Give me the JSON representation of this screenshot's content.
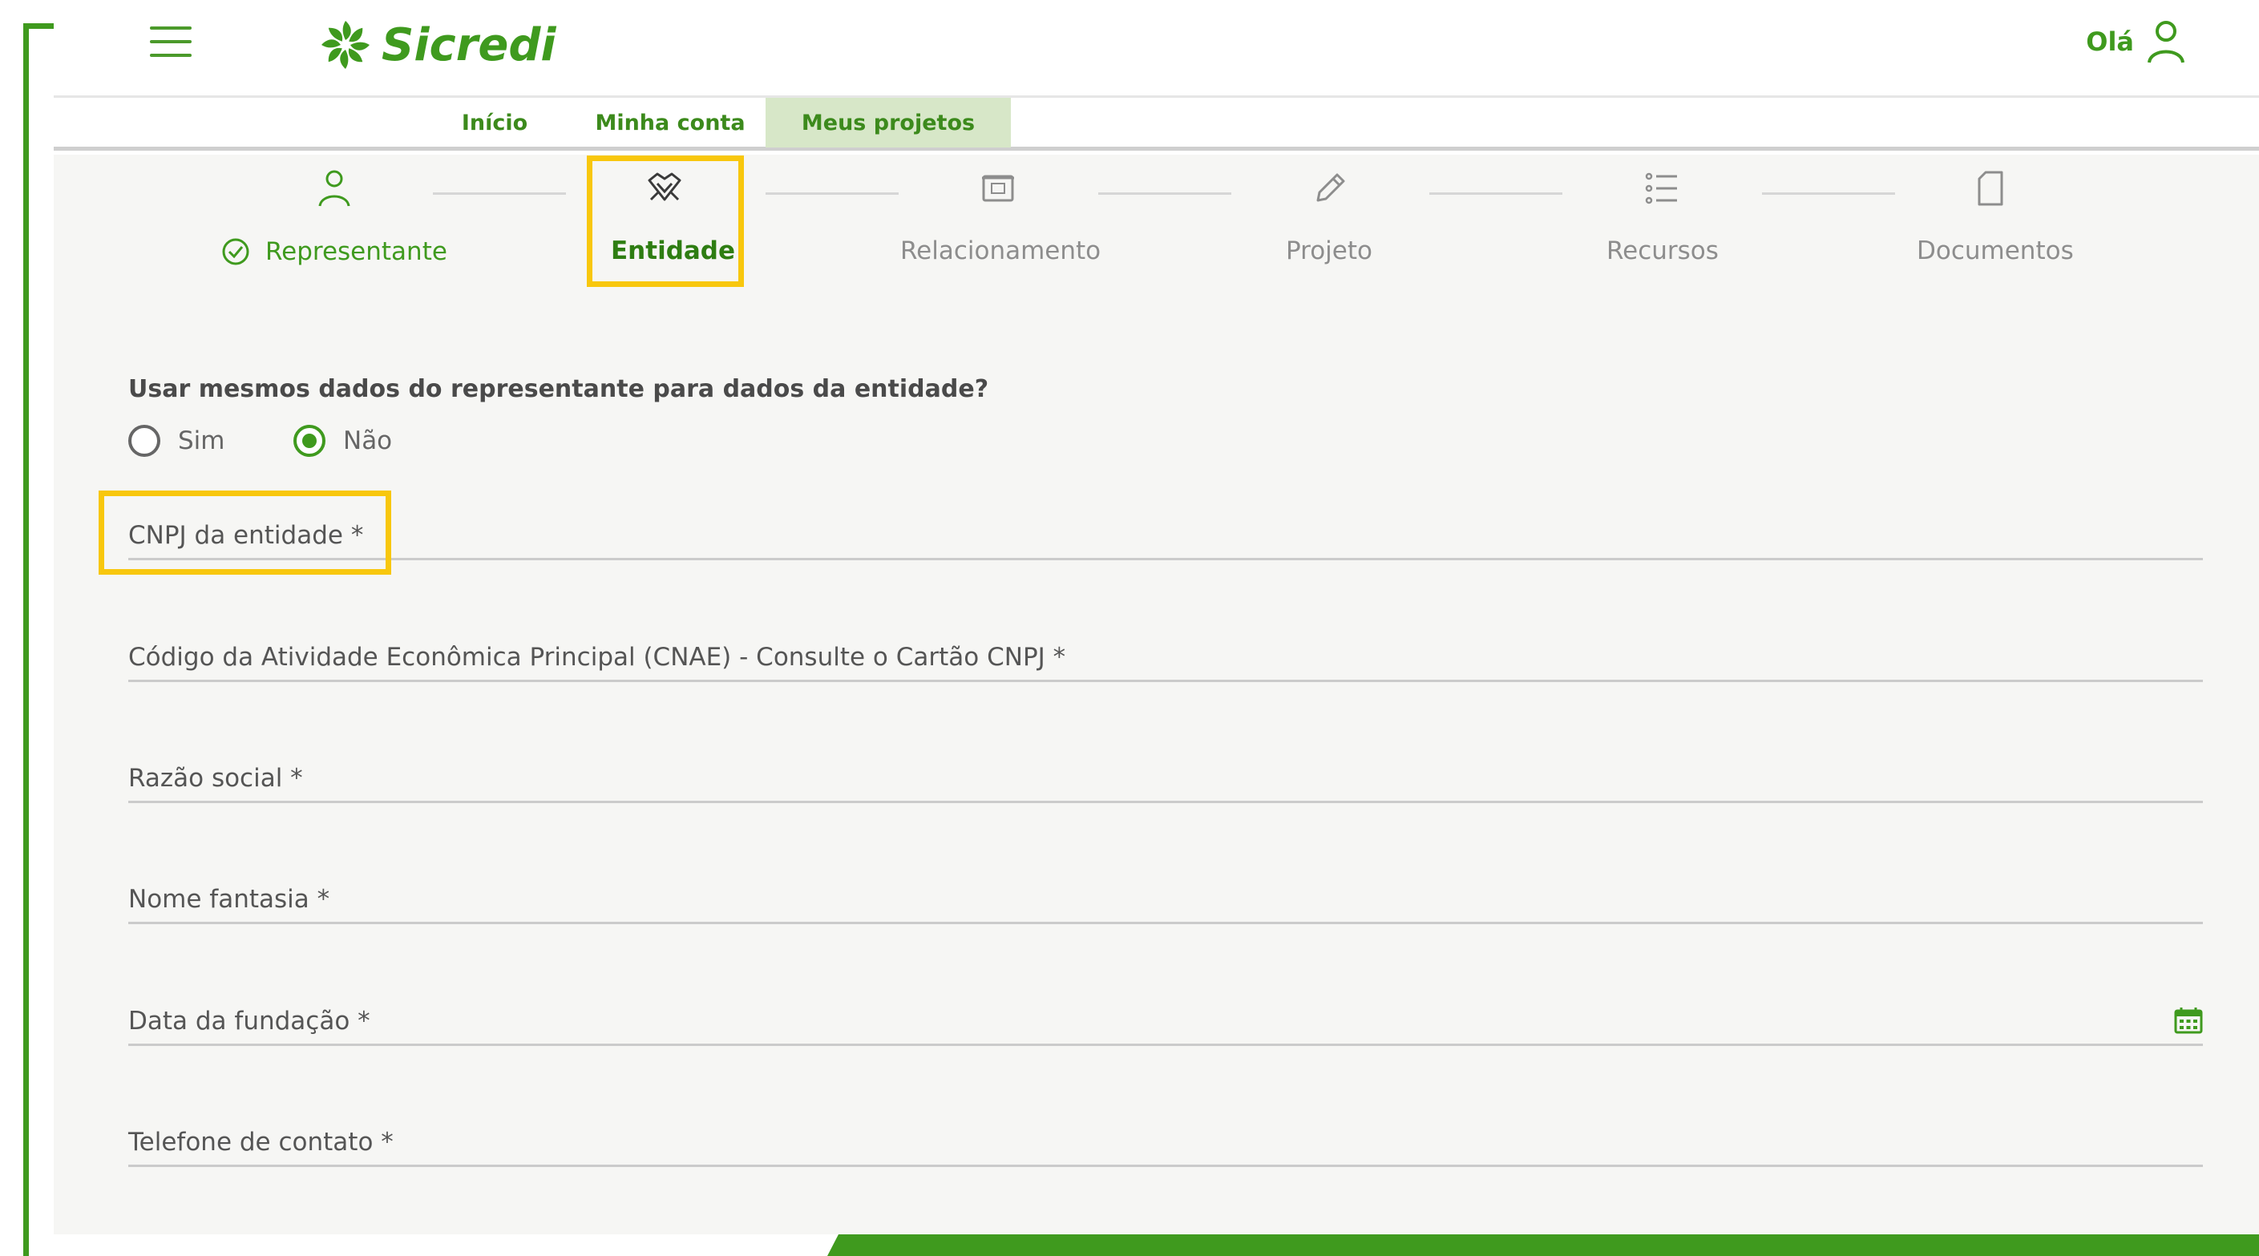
{
  "header": {
    "logo_text": "Sicredi",
    "greeting": "Olá",
    "brand_color": "#3f9a1e"
  },
  "nav": {
    "tabs": [
      {
        "label": "Início",
        "active": false
      },
      {
        "label": "Minha conta",
        "active": false
      },
      {
        "label": "Meus projetos",
        "active": true
      }
    ]
  },
  "stepper": {
    "steps": [
      {
        "label": "Representante",
        "icon": "person-icon",
        "state": "done"
      },
      {
        "label": "Entidade",
        "icon": "handshake-icon",
        "state": "active"
      },
      {
        "label": "Relacionamento",
        "icon": "bank-card-icon",
        "state": "pending"
      },
      {
        "label": "Projeto",
        "icon": "pencil-icon",
        "state": "pending"
      },
      {
        "label": "Recursos",
        "icon": "list-icon",
        "state": "pending"
      },
      {
        "label": "Documentos",
        "icon": "document-icon",
        "state": "pending"
      }
    ]
  },
  "form": {
    "question": "Usar mesmos dados do representante para dados da entidade?",
    "options": [
      {
        "label": "Sim",
        "checked": false
      },
      {
        "label": "Não",
        "checked": true
      }
    ],
    "fields": [
      {
        "label": "CNPJ da entidade *",
        "value": ""
      },
      {
        "label": "Código da Atividade Econômica Principal (CNAE) - Consulte o Cartão CNPJ *",
        "value": ""
      },
      {
        "label": "Razão social *",
        "value": ""
      },
      {
        "label": "Nome fantasia *",
        "value": ""
      },
      {
        "label": "Data da fundação *",
        "value": "",
        "icon": "calendar-icon"
      },
      {
        "label": "Telefone de contato *",
        "value": ""
      }
    ]
  },
  "annotations": {
    "highlight_color": "#f8c70d"
  }
}
